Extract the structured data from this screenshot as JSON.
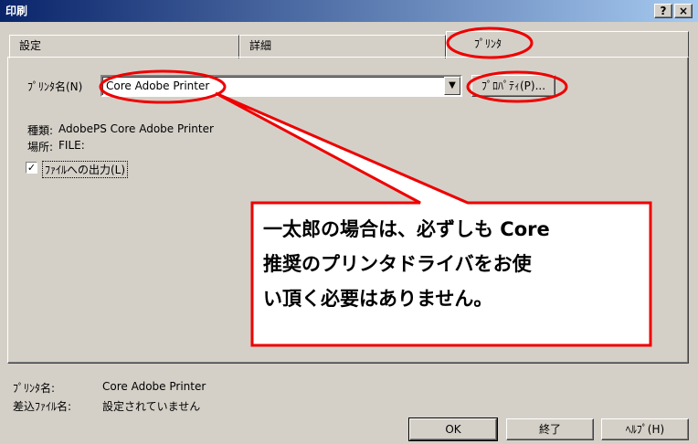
{
  "window": {
    "title": "印刷",
    "help_button": "?",
    "close_button": "×"
  },
  "tabs": [
    {
      "label": "設定"
    },
    {
      "label": "詳細"
    },
    {
      "label": "ﾌﾟﾘﾝﾀ",
      "selected": true
    }
  ],
  "printer": {
    "name_label": "ﾌﾟﾘﾝﾀ名(N)",
    "name_value": "Core Adobe Printer",
    "properties_button": "ﾌﾟﾛﾊﾟﾃｨ(P)...",
    "type_label": "種類:",
    "type_value": "AdobePS Core Adobe Printer",
    "location_label": "場所:",
    "location_value": "FILE:",
    "print_to_file_label": "ﾌｧｲﾙへの出力(L)",
    "print_to_file_checked": true
  },
  "callout": {
    "lines": [
      "一太郎の場合は、必ずしも Core",
      "推奨のプリンタドライバをお使",
      "い頂く必要はありません。"
    ]
  },
  "footer": {
    "printer_label": "ﾌﾟﾘﾝﾀ名:",
    "printer_value": "Core Adobe Printer",
    "merge_label": "差込ﾌｧｲﾙ名:",
    "merge_value": "設定されていません",
    "ok_button": "OK",
    "close_button": "終了",
    "help_button": "ﾍﾙﾌﾟ(H)"
  },
  "colors": {
    "annotation": "#ee0000",
    "titlebar_start": "#0a246a",
    "titlebar_end": "#a6caf0"
  }
}
